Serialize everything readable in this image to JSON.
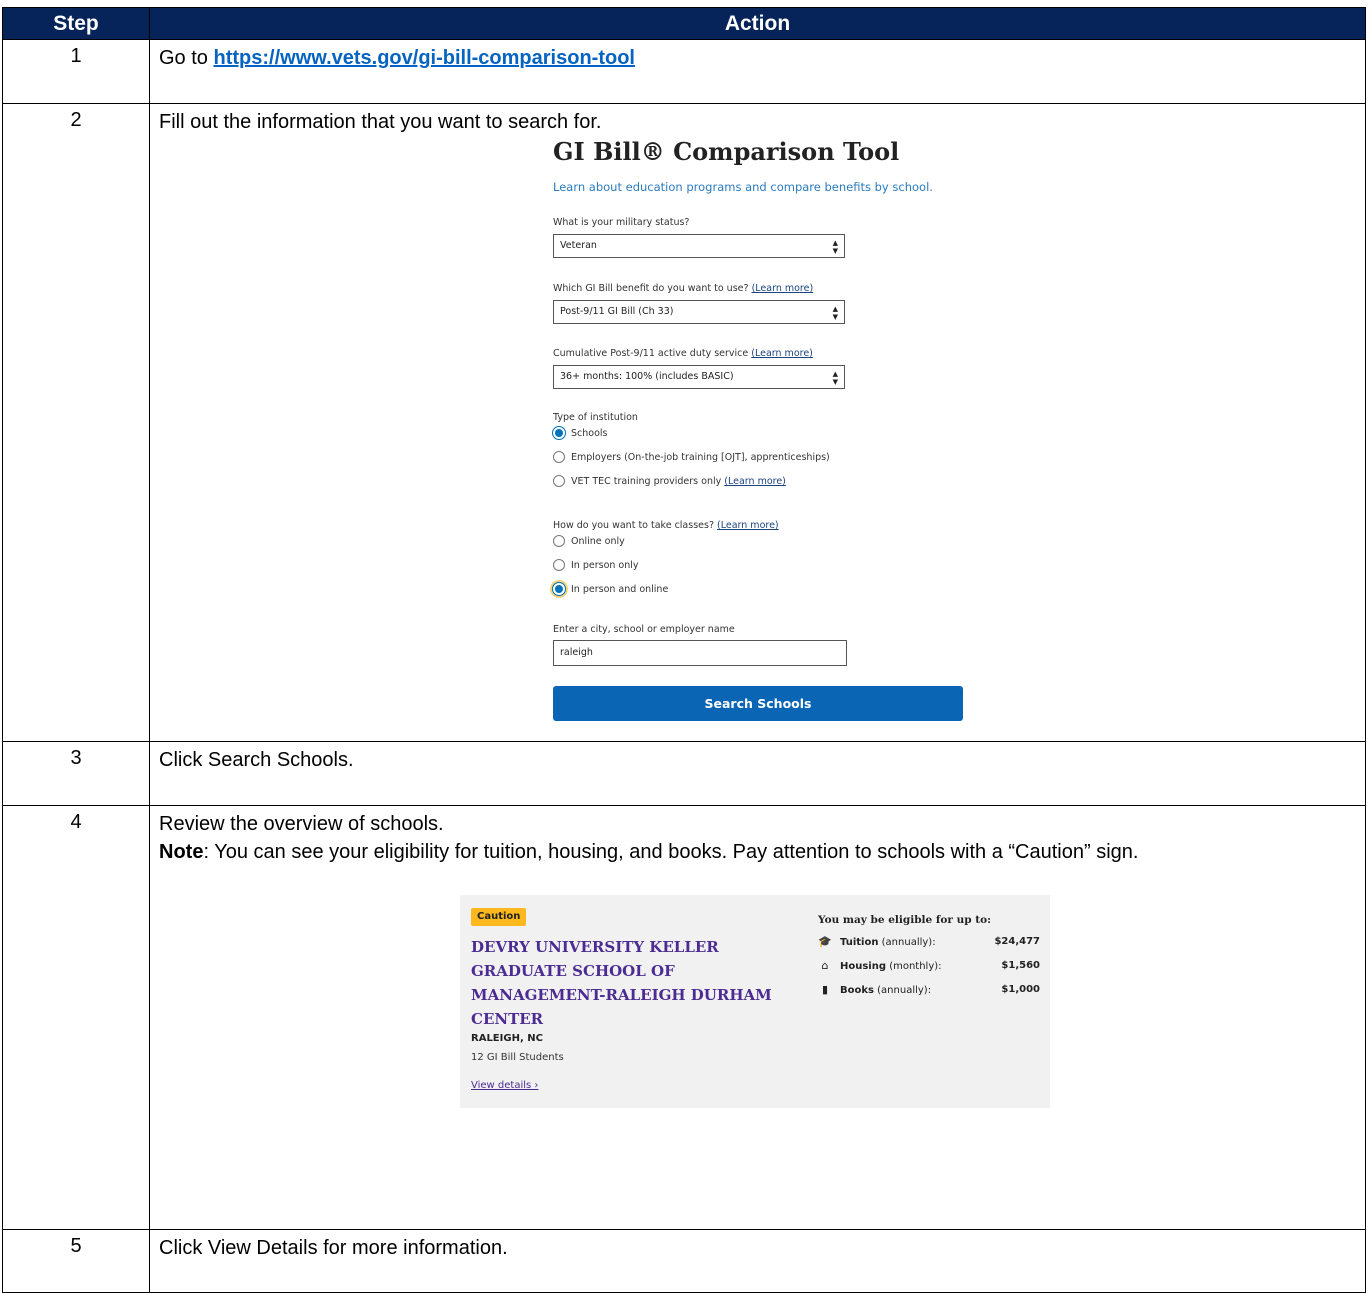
{
  "table": {
    "header_step": "Step",
    "header_action": "Action"
  },
  "rows": [
    {
      "num": "1",
      "text": "Go to ",
      "link": "https://www.vets.gov/gi-bill-comparison-tool"
    },
    {
      "num": "2",
      "text": "Fill out the information that you want to search for."
    },
    {
      "num": "3",
      "text": "Click Search Schools."
    },
    {
      "num": "4",
      "text": "Review the overview of schools.",
      "note_label": "Note",
      "note_text": ": You can see your eligibility for tuition, housing, and books. Pay attention to schools with a “Caution” sign."
    },
    {
      "num": "5",
      "text": "Click View Details for more information."
    }
  ],
  "gi_tool": {
    "title": "GI Bill® Comparison Tool",
    "subtitle": "Learn about education programs and compare benefits by school.",
    "military_status_label": "What is your military status?",
    "military_status_value": "Veteran",
    "benefit_label": "Which GI Bill benefit do you want to use?",
    "benefit_learn_more": "(Learn more)",
    "benefit_value": "Post-9/11 GI Bill (Ch 33)",
    "service_label": "Cumulative Post-9/11 active duty service",
    "service_learn_more": "(Learn more)",
    "service_value": "36+ months: 100% (includes BASIC)",
    "institution_label": "Type of institution",
    "institution_options": [
      "Schools",
      "Employers (On-the-job training [OJT], apprenticeships)",
      "VET TEC training providers only"
    ],
    "institution_learn_more": "(Learn more)",
    "institution_selected": "Schools",
    "classes_label": "How do you want to take classes?",
    "classes_learn_more": "(Learn more)",
    "classes_options": [
      "Online only",
      "In person only",
      "In person and online"
    ],
    "classes_selected": "In person and online",
    "search_label": "Enter a city, school or employer name",
    "search_value": "raleigh",
    "search_button": "Search Schools",
    "select_icon": "sort-caret-icon"
  },
  "school_card": {
    "badge": "Caution",
    "name": "DEVRY UNIVERSITY KELLER GRADUATE SCHOOL OF MANAGEMENT-RALEIGH DURHAM CENTER",
    "city": "RALEIGH, NC",
    "students": "12 GI Bill Students",
    "view_details": "View details ›",
    "eligible_header": "You may be eligible for up to:",
    "benefits": [
      {
        "icon": "graduation-cap-icon",
        "name": "Tuition",
        "period": "(annually):",
        "value": "$24,477"
      },
      {
        "icon": "home-icon",
        "name": "Housing",
        "period": "(monthly):",
        "value": "$1,560"
      },
      {
        "icon": "book-icon",
        "name": "Books",
        "period": "(annually):",
        "value": "$1,000"
      }
    ]
  },
  "colors": {
    "header_bg": "#06245a",
    "link": "#0563c1",
    "primary_button": "#0b65b5",
    "caution": "#fdb81e",
    "school_name": "#4c2c92"
  }
}
